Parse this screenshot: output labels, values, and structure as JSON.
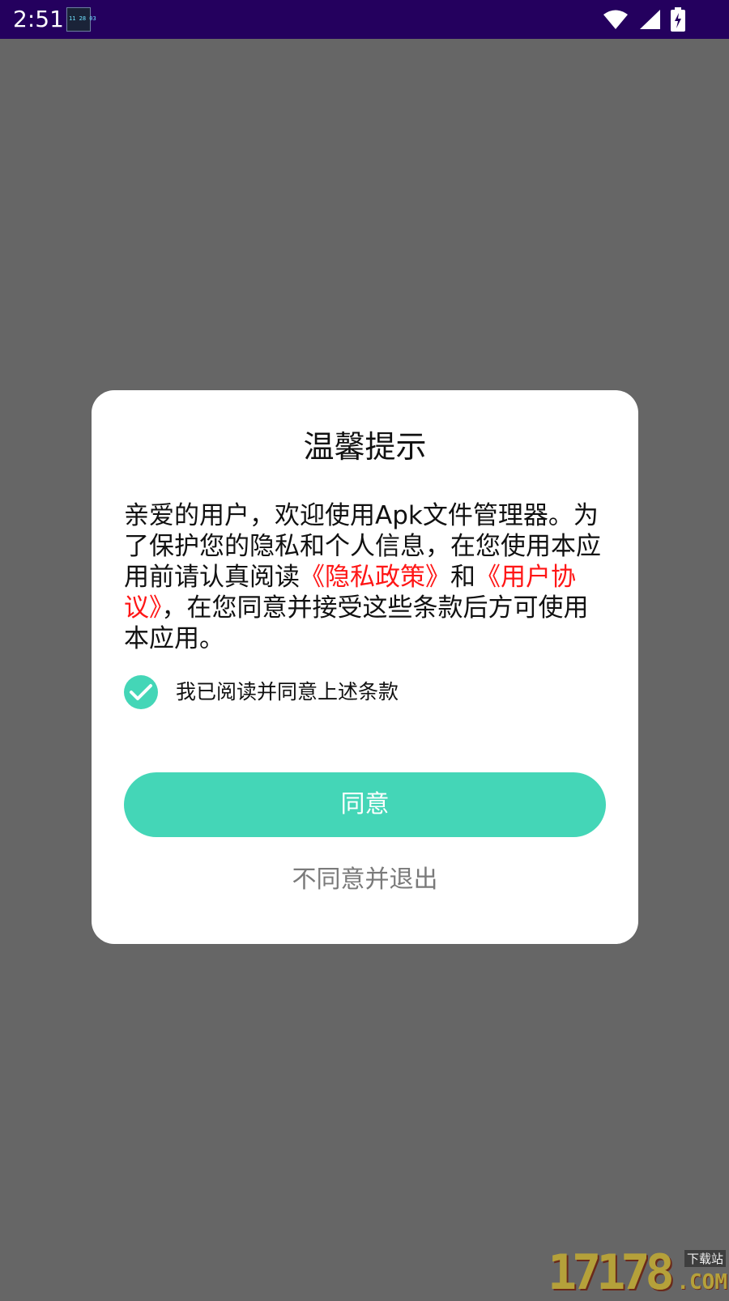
{
  "status_bar": {
    "time": "2:51",
    "app_icon": "clock-widget-icon",
    "icons": [
      "wifi-icon",
      "cellular-signal-icon",
      "battery-charging-icon"
    ],
    "background_color": "#24005e"
  },
  "dialog": {
    "title": "温馨提示",
    "body": {
      "part1": "亲爱的用户，欢迎使用Apk文件管理器。为了保护您的隐私和个人信息，在您使用本应用前请认真阅读",
      "privacy_link": "《隐私政策》",
      "part2": "和",
      "agreement_link": "《用户协议》",
      "part3": "，在您同意并接受这些条款后方可使用本应用。"
    },
    "consent": {
      "checked": true,
      "label": "我已阅读并同意上述条款"
    },
    "agree_button": "同意",
    "decline_button": "不同意并退出"
  },
  "watermark": {
    "number": "17178",
    "tag": "下载站",
    "suffix": ".COM"
  },
  "colors": {
    "accent": "#44d6b7",
    "link": "#ff1616",
    "overlay": "#666666",
    "decline_text": "#7a7a7a"
  }
}
